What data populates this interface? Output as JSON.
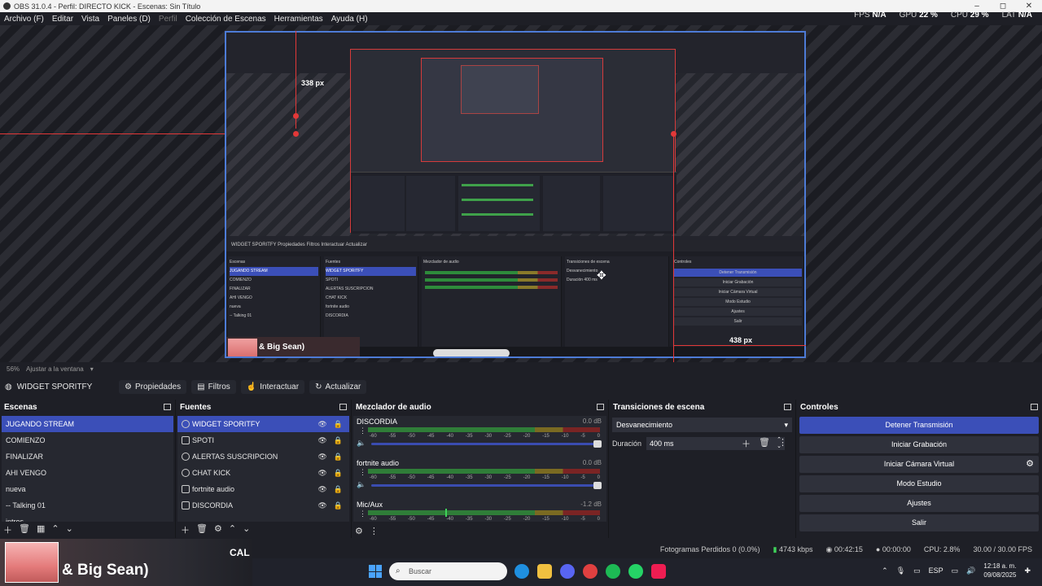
{
  "window": {
    "title": "OBS 31.0.4 - Perfil: DIRECTO KICK - Escenas: Sin Título",
    "controls": [
      "–",
      "◻",
      "✕"
    ]
  },
  "menu": [
    "Archivo (F)",
    "Editar",
    "Vista",
    "Paneles (D)",
    "Perfil",
    "Colección de Escenas",
    "Herramientas",
    "Ayuda (H)"
  ],
  "stats": {
    "fps_label": "FPS",
    "fps_value": "N/A",
    "gpu_label": "GPU",
    "gpu_value": "22 %",
    "cpu_label": "CPU",
    "cpu_value": "29 %",
    "lat_label": "LAT",
    "lat_value": "N/A"
  },
  "preview": {
    "guide_top": "338 px",
    "guide_right": "438 px",
    "zoom": "56%",
    "fit_label": "Ajustar a la ventana",
    "inner": {
      "toolbar": "WIDGET SPORITFY  Propiedades  Filtros  Interactuar  Actualizar",
      "scenes_head": "Escenas",
      "scenes": [
        "JUGANDO STREAM",
        "COMIENZO",
        "FINALIZAR",
        "AHI VENGO",
        "nueva",
        "-- Talking 01"
      ],
      "sources_head": "Fuentes",
      "sources": [
        "WIDGET SPORITFY",
        "SPOTI",
        "ALERTAS SUSCRIPCION",
        "CHAT KICK",
        "fortnite audio",
        "DISCORDIA"
      ],
      "mixer_head": "Mezclador de audio",
      "trans_head": "Transiciones de escena",
      "trans_value": "Desvanecimiento",
      "trans_dur": "Duración  400 ms",
      "controls_head": "Controles",
      "controls": [
        "Detener Transmisión",
        "Iniciar Grabación",
        "Iniciar Cámara Virtual",
        "Modo Estudio",
        "Ajustes",
        "Salir"
      ],
      "overlay_text": "& Big Sean)"
    }
  },
  "source_toolbar": {
    "source_name": "WIDGET SPORITFY",
    "buttons": [
      "Propiedades",
      "Filtros",
      "Interactuar",
      "Actualizar"
    ]
  },
  "scenes": {
    "title": "Escenas",
    "items": [
      "JUGANDO STREAM",
      "COMIENZO",
      "FINALIZAR",
      "AHI VENGO",
      "nueva",
      "-- Talking 01",
      "intros"
    ],
    "selected": 0
  },
  "sources": {
    "title": "Fuentes",
    "items": [
      {
        "name": "WIDGET SPORITFY",
        "icon": "browser-icon"
      },
      {
        "name": "SPOTI",
        "icon": "window-icon"
      },
      {
        "name": "ALERTAS SUSCRIPCION",
        "icon": "browser-icon"
      },
      {
        "name": "CHAT KICK",
        "icon": "browser-icon"
      },
      {
        "name": "fortnite audio",
        "icon": "window-icon"
      },
      {
        "name": "DISCORDIA",
        "icon": "window-icon"
      }
    ],
    "selected": 0
  },
  "mixer": {
    "title": "Mezclador de audio",
    "ticks": [
      "-60",
      "-55",
      "-50",
      "-45",
      "-40",
      "-35",
      "-30",
      "-25",
      "-20",
      "-15",
      "-10",
      "-5",
      "0"
    ],
    "channels": [
      {
        "name": "DISCORDIA",
        "db": "0.0 dB",
        "level": 1.0
      },
      {
        "name": "fortnite audio",
        "db": "0.0 dB",
        "level": 1.0
      },
      {
        "name": "Mic/Aux",
        "db": "-1.2 dB",
        "level": 0.4
      }
    ]
  },
  "transitions": {
    "title": "Transiciones de escena",
    "selected": "Desvanecimiento",
    "duration_label": "Duración",
    "duration_value": "400 ms"
  },
  "controls": {
    "title": "Controles",
    "buttons": [
      "Detener Transmisión",
      "Iniciar Grabación",
      "Iniciar Cámara Virtual",
      "Modo Estudio",
      "Ajustes",
      "Salir"
    ]
  },
  "status": {
    "dropped": "Fotogramas Perdidos 0 (0.0%)",
    "bitrate": "4743 kbps",
    "live_time": "00:42:15",
    "rec_time": "00:00:00",
    "cpu": "CPU: 2.8%",
    "fps": "30.00 / 30.00 FPS"
  },
  "overlay": {
    "text": "& Big Sean)",
    "cal": "CAL"
  },
  "taskbar": {
    "search_placeholder": "Buscar",
    "lang": "ESP",
    "time": "12:18 a. m.",
    "date": "09/08/2025"
  },
  "colors": {
    "accent": "#3b4fb8",
    "guide": "#e23838",
    "meter_green": "#2f7d38",
    "meter_yellow": "#7a6a22",
    "meter_red": "#7a2424"
  }
}
